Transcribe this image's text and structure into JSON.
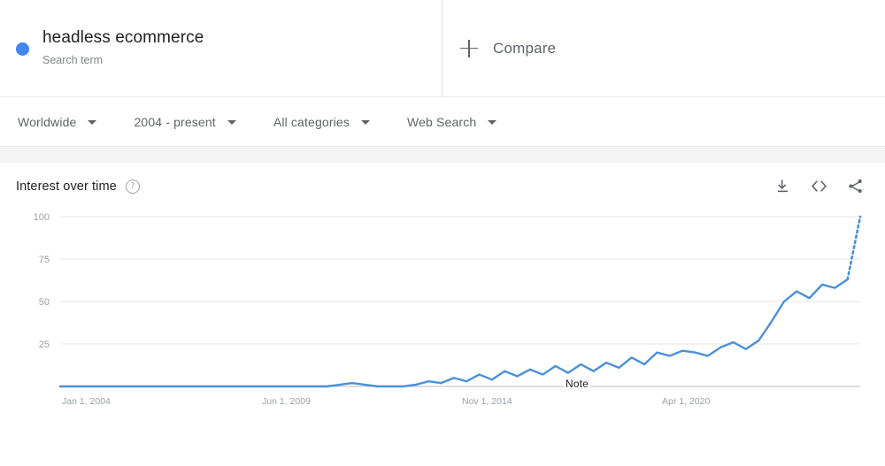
{
  "header": {
    "term": {
      "label": "headless ecommerce",
      "subtitle": "Search term",
      "dot_color": "#4285f4"
    },
    "compare": {
      "label": "Compare",
      "icon": "plus-icon"
    }
  },
  "filters": [
    {
      "label": "Worldwide",
      "icon": "chevron-down-icon"
    },
    {
      "label": "2004 - present",
      "icon": "chevron-down-icon"
    },
    {
      "label": "All categories",
      "icon": "chevron-down-icon"
    },
    {
      "label": "Web Search",
      "icon": "chevron-down-icon"
    }
  ],
  "card": {
    "title": "Interest over time",
    "help_icon": "?",
    "actions": [
      {
        "name": "download-icon"
      },
      {
        "name": "embed-code-icon"
      },
      {
        "name": "share-icon"
      }
    ]
  },
  "chart_data": {
    "type": "line",
    "title": "Interest over time",
    "xlabel": "",
    "ylabel": "",
    "ylim": [
      0,
      100
    ],
    "grid": true,
    "legend": false,
    "line_color": "#4a90d9",
    "annotations": [
      {
        "text": "Note",
        "x": "Nov 1, 2014",
        "y": 0
      }
    ],
    "partial_data_indicator": true,
    "xticks": [
      "Jan 1, 2004",
      "Jun 1, 2009",
      "Nov 1, 2014",
      "Apr 1, 2020"
    ],
    "yticks": [
      25,
      50,
      75,
      100
    ],
    "x": [
      "2004-01",
      "2004-07",
      "2005-01",
      "2005-07",
      "2006-01",
      "2006-07",
      "2007-01",
      "2007-07",
      "2008-01",
      "2008-07",
      "2009-01",
      "2009-07",
      "2010-01",
      "2010-07",
      "2011-01",
      "2011-07",
      "2012-01",
      "2012-07",
      "2013-01",
      "2013-07",
      "2014-01",
      "2014-07",
      "2015-01",
      "2015-04",
      "2015-07",
      "2015-10",
      "2016-01",
      "2016-04",
      "2016-07",
      "2016-10",
      "2017-01",
      "2017-03",
      "2017-05",
      "2017-07",
      "2017-09",
      "2017-11",
      "2018-01",
      "2018-03",
      "2018-05",
      "2018-07",
      "2018-09",
      "2018-11",
      "2019-01",
      "2019-03",
      "2019-05",
      "2019-07",
      "2019-09",
      "2019-11",
      "2020-01",
      "2020-03",
      "2020-05",
      "2020-07",
      "2020-09",
      "2020-11",
      "2021-01",
      "2021-03",
      "2021-05",
      "2021-07",
      "2021-09",
      "2021-11",
      "2022-01",
      "2022-03",
      "2022-05",
      "2022-07"
    ],
    "values": [
      0,
      0,
      0,
      0,
      0,
      0,
      0,
      0,
      0,
      0,
      0,
      0,
      0,
      0,
      0,
      0,
      0,
      0,
      0,
      0,
      0,
      0,
      1,
      2,
      1,
      0,
      0,
      0,
      1,
      3,
      2,
      5,
      3,
      7,
      4,
      9,
      6,
      10,
      7,
      12,
      8,
      13,
      9,
      14,
      11,
      17,
      13,
      20,
      18,
      21,
      20,
      18,
      23,
      26,
      22,
      27,
      38,
      50,
      56,
      52,
      60,
      58,
      63,
      100
    ],
    "series_name": "headless ecommerce"
  }
}
